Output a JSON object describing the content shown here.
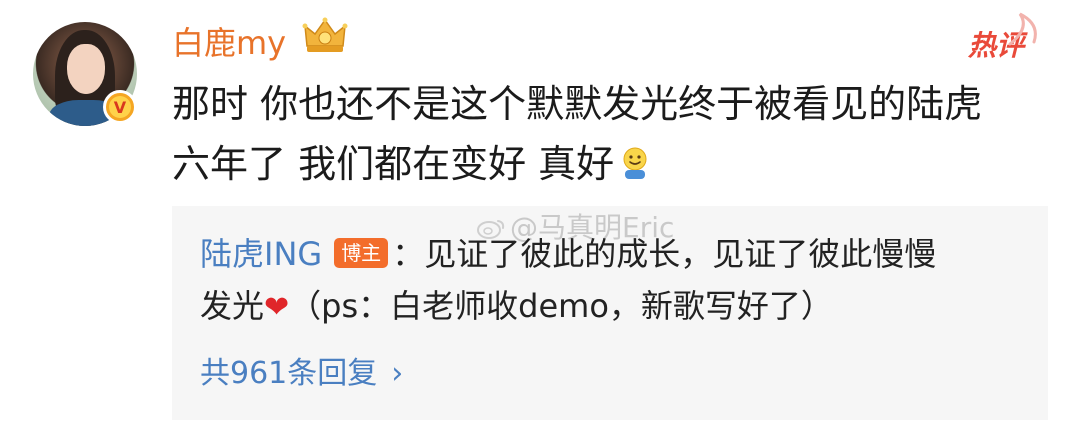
{
  "post": {
    "username": "白鹿my",
    "hot_tag": "热评",
    "content_lines": [
      "那时 你也还不是这个默默发光终于被看见的陆虎",
      "六年了 我们都在变好 真好"
    ],
    "emoji": "smiling-face-emoji"
  },
  "watermark": "@马真明Eric",
  "reply": {
    "author": "陆虎ING",
    "badge": "博主",
    "line1": "：见证了彼此的成长，见证了彼此慢慢",
    "line2_prefix": "发光",
    "line2_suffix": "（ps：白老师收demo，新歌写好了）",
    "count_label": "共961条回复",
    "chevron": "›"
  },
  "colors": {
    "username": "#e8732a",
    "link": "#4a7fc1",
    "badge": "#f36d2b",
    "hot": "#e94a3a",
    "reply_bg": "#f6f6f6"
  }
}
